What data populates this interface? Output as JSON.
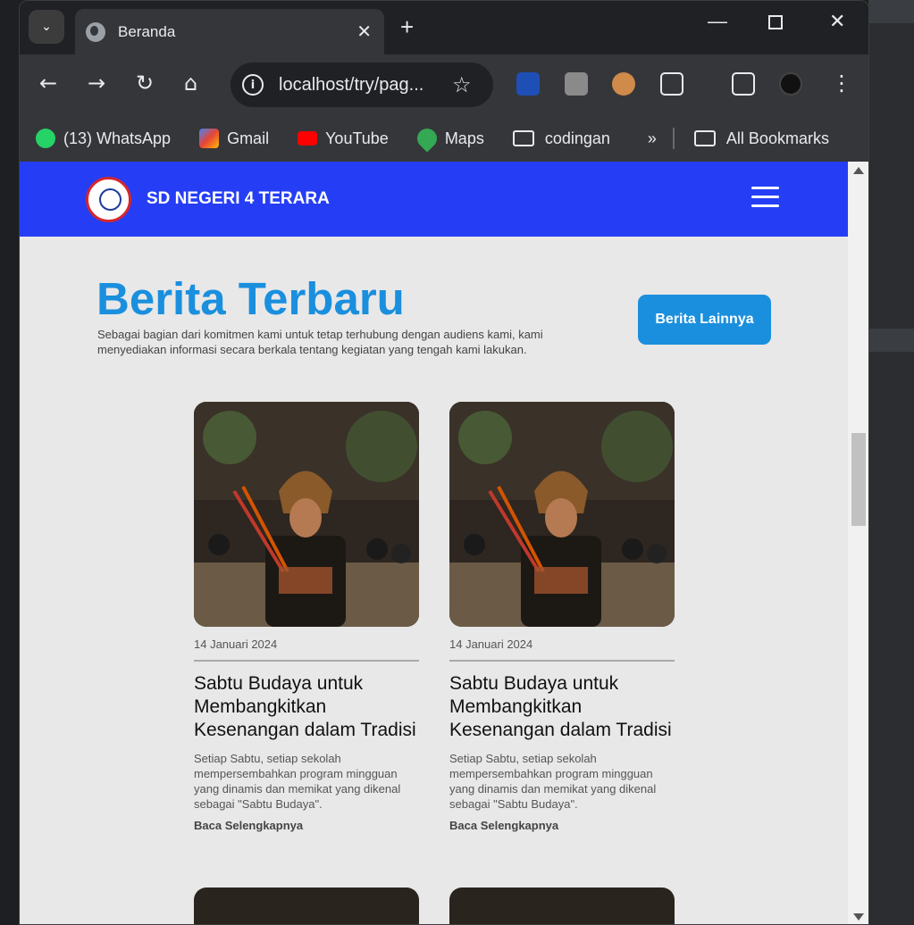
{
  "browser": {
    "tab_title": "Beranda",
    "url": "localhost/try/pag...",
    "bookmarks": [
      {
        "label": "(13) WhatsApp",
        "icon": "whatsapp-icon",
        "color": "#25d366"
      },
      {
        "label": "Gmail",
        "icon": "gmail-icon",
        "color": "#ea4335"
      },
      {
        "label": "YouTube",
        "icon": "youtube-icon",
        "color": "#ff0000"
      },
      {
        "label": "Maps",
        "icon": "maps-icon",
        "color": "#34a853"
      },
      {
        "label": "codingan",
        "icon": "folder-icon",
        "color": "#e8eaed"
      }
    ],
    "all_bookmarks": "All Bookmarks",
    "overflow": "»"
  },
  "site": {
    "name": "SD NEGERI 4 TERARA",
    "brand_color": "#253ef5",
    "accent_color": "#1a8fde"
  },
  "section": {
    "title": "Berita Terbaru",
    "description": "Sebagai bagian dari komitmen kami untuk tetap terhubung dengan audiens kami, kami menyediakan informasi secara berkala tentang kegiatan yang tengah kami lakukan.",
    "more_button": "Berita Lainnya"
  },
  "news": [
    {
      "date": "14 Januari 2024",
      "title": "Sabtu Budaya untuk Membangkitkan Kesenangan dalam Tradisi",
      "desc": "Setiap Sabtu, setiap sekolah mempersembahkan program mingguan yang dinamis dan memikat yang dikenal sebagai \"Sabtu Budaya\".",
      "read_more": "Baca Selengkapnya"
    },
    {
      "date": "14 Januari 2024",
      "title": "Sabtu Budaya untuk Membangkitkan Kesenangan dalam Tradisi",
      "desc": "Setiap Sabtu, setiap sekolah mempersembahkan program mingguan yang dinamis dan memikat yang dikenal sebagai \"Sabtu Budaya\".",
      "read_more": "Baca Selengkapnya"
    }
  ]
}
